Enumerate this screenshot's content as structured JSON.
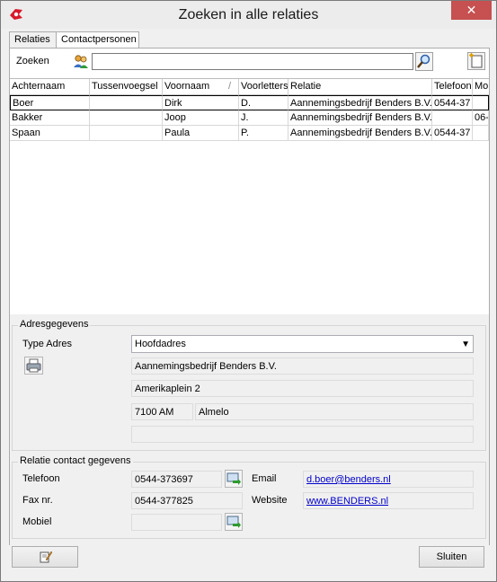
{
  "window": {
    "title": "Zoeken in alle relaties",
    "close_label": "✕"
  },
  "tabs": [
    {
      "label": "Relaties"
    },
    {
      "label": "Contactpersonen"
    }
  ],
  "search": {
    "label": "Zoeken",
    "value": ""
  },
  "grid": {
    "columns": [
      "Achternaam",
      "Tussenvoegsel",
      "Voornaam",
      "Voorletters",
      "Relatie",
      "Telefoon",
      "Mo"
    ],
    "sort_marker": "/",
    "rows": [
      [
        "Boer",
        "",
        "Dirk",
        "D.",
        "Aannemingsbedrijf Benders B.V.",
        "0544-37",
        ""
      ],
      [
        "Bakker",
        "",
        "Joop",
        "J.",
        "Aannemingsbedrijf Benders B.V.",
        "",
        "06-"
      ],
      [
        "Spaan",
        "",
        "Paula",
        "P.",
        "Aannemingsbedrijf Benders B.V.",
        "0544-37",
        ""
      ]
    ]
  },
  "address": {
    "group_title": "Adresgegevens",
    "type_label": "Type Adres",
    "type_value": "Hoofdadres",
    "line1": "Aannemingsbedrijf Benders B.V.",
    "line2": "Amerikaplein 2",
    "postcode": "7100 AM",
    "city": "Almelo",
    "line4": ""
  },
  "contact": {
    "group_title": "Relatie contact gegevens",
    "phone_label": "Telefoon",
    "phone_value": "0544-373697",
    "fax_label": "Fax nr.",
    "fax_value": "0544-377825",
    "mobile_label": "Mobiel",
    "mobile_value": "",
    "email_label": "Email",
    "email_value": "d.boer@benders.nl",
    "website_label": "Website",
    "website_value": "www.BENDERS.nl"
  },
  "footer": {
    "close_label": "Sluiten"
  }
}
